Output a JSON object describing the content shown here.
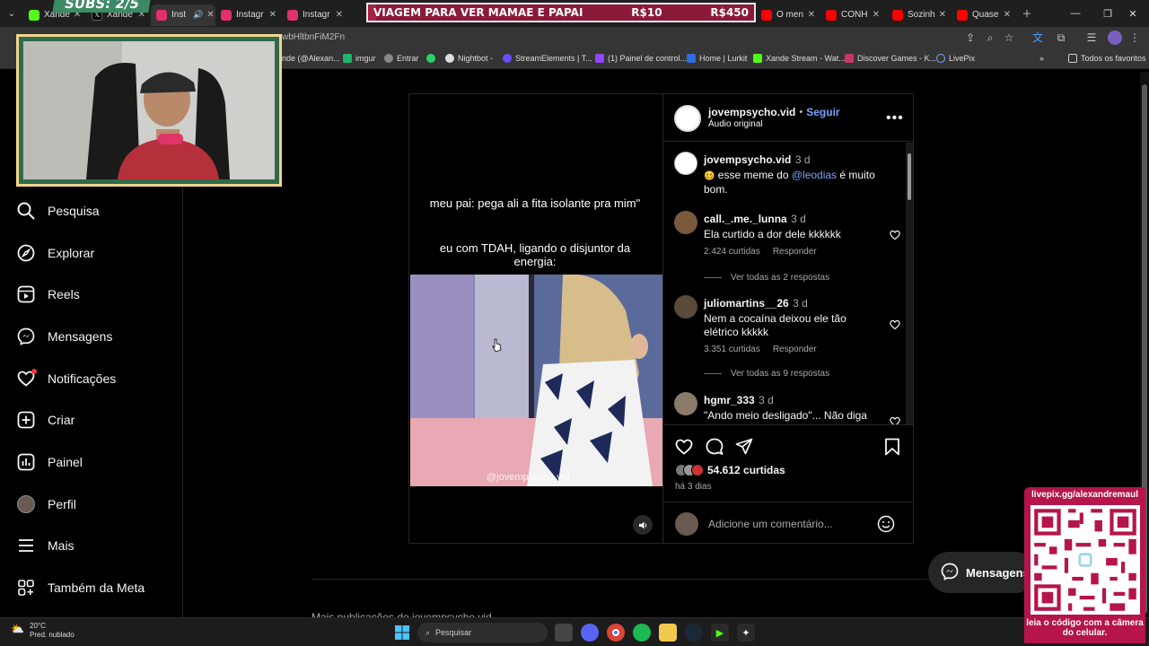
{
  "tabs": [
    {
      "label": "Xande",
      "icon": "kick-icon",
      "color": "#53fc18",
      "active": false
    },
    {
      "label": "Xande",
      "icon": "x-icon",
      "color": "#000000",
      "active": false
    },
    {
      "label": "Inst",
      "icon": "instagram-icon",
      "color": "#e1306c",
      "active": true
    },
    {
      "label": "Instagr",
      "icon": "instagram-icon",
      "color": "#e1306c",
      "active": false
    },
    {
      "label": "Instagr",
      "icon": "instagram-icon",
      "color": "#e1306c",
      "active": false
    },
    {
      "label": "O men",
      "icon": "youtube-icon",
      "color": "#ff0000",
      "active": false
    },
    {
      "label": "CONH",
      "icon": "youtube-icon",
      "color": "#ff0000",
      "active": false
    },
    {
      "label": "Sozinh",
      "icon": "youtube-icon",
      "color": "#ff0000",
      "active": false
    },
    {
      "label": "Quase",
      "icon": "youtube-icon",
      "color": "#ff0000",
      "active": false
    }
  ],
  "banner": {
    "text": "VIAGEM PARA VER MAMAE E PAPAI",
    "current": "R$10",
    "goal": "R$450",
    "progress": 0.022
  },
  "address": {
    "url": "wbHltbnFiM2Fn"
  },
  "bookmarks": [
    {
      "label": "nde (@Alexan...",
      "color": "#e1306c"
    },
    {
      "label": "imgur",
      "color": "#1bb76e"
    },
    {
      "label": "Entrar",
      "color": "#cccccc"
    },
    {
      "label": "",
      "color": "#25d366"
    },
    {
      "label": "Nightbot -",
      "color": "#cccccc"
    },
    {
      "label": "StreamElements | T...",
      "color": "#6c4bff"
    },
    {
      "label": "(1) Painel de control...",
      "color": "#9146ff"
    },
    {
      "label": "Home | Lurkit",
      "color": "#2d6cdf"
    },
    {
      "label": "Xande Stream - Wat...",
      "color": "#53fc18"
    },
    {
      "label": "Discover Games - K...",
      "color": "#cc3366"
    },
    {
      "label": "LivePix",
      "color": "#7aa2ff"
    },
    {
      "label": "Todos os favoritos",
      "color": "#cccccc"
    }
  ],
  "webcam": {
    "subs_label": "SUBS: 2/5"
  },
  "nav": [
    {
      "label": "Pesquisa",
      "icon": "search-icon"
    },
    {
      "label": "Explorar",
      "icon": "compass-icon"
    },
    {
      "label": "Reels",
      "icon": "reels-icon"
    },
    {
      "label": "Mensagens",
      "icon": "messenger-icon"
    },
    {
      "label": "Notificações",
      "icon": "heart-icon"
    },
    {
      "label": "Criar",
      "icon": "plus-square-icon"
    },
    {
      "label": "Painel",
      "icon": "dashboard-icon"
    },
    {
      "label": "Perfil",
      "icon": "profile-avatar-icon"
    },
    {
      "label": "Mais",
      "icon": "menu-icon"
    },
    {
      "label": "Também da Meta",
      "icon": "meta-icon"
    }
  ],
  "post": {
    "author": "jovempsycho.vid",
    "follow": "Seguir",
    "separator": "•",
    "audio": "Áudio original",
    "caption_top": "meu pai: pega ali a fita isolante pra mim\"",
    "caption_bottom": "eu com TDAH, ligando o disjuntor da energia:",
    "watermark": "@jovempsycho.vid",
    "description": {
      "author": "jovempsycho.vid",
      "time": "3 d",
      "text_before": "esse meme do ",
      "mention": "@leodias",
      "text_after": " é muito bom."
    },
    "comments": [
      {
        "user": "call._.me._lunna",
        "time": "3 d",
        "text": "Ela curtido a dor dele kkkkkk",
        "likes": "2.424 curtidas",
        "reply": "Responder",
        "view_replies": "Ver todas as 2 respostas"
      },
      {
        "user": "juliomartins__26",
        "time": "3 d",
        "text": "Nem a cocaína deixou ele tão elétrico kkkkk",
        "likes": "3.351 curtidas",
        "reply": "Responder",
        "view_replies": "Ver todas as 9 respostas"
      },
      {
        "user": "hgmr_333",
        "time": "3 d",
        "text": "\"Ando meio desligado\"... Não diga mais nada !!!",
        "likes": "",
        "reply": "",
        "view_replies": ""
      }
    ],
    "likes": "54.612 curtidas",
    "posted": "há 3 dias",
    "add_comment_placeholder": "Adicione um comentário..."
  },
  "more_publications": "Mais publicações de jovempsycho.vid",
  "messages_button": "Mensagens",
  "qr": {
    "top": "livepix.gg/alexandremaul",
    "bottom": "leia o código com a câmera do celular."
  },
  "taskbar": {
    "temp": "20°C",
    "weather": "Pred. nublado",
    "search": "Pesquisar"
  }
}
